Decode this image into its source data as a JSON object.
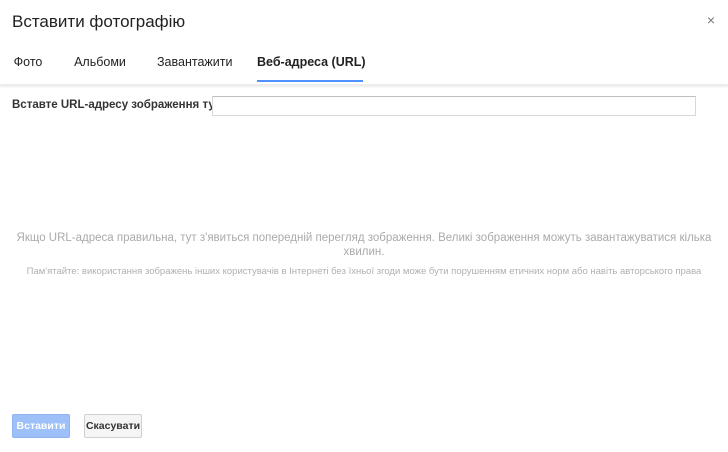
{
  "dialog": {
    "title": "Вставити фотографію",
    "close_glyph": "×"
  },
  "tabs": [
    {
      "label": "Фото",
      "active": false
    },
    {
      "label": "Альбоми",
      "active": false
    },
    {
      "label": "Завантажити",
      "active": false
    },
    {
      "label": "Веб-адреса (URL)",
      "active": true
    }
  ],
  "url_form": {
    "label": "Вставте URL-адресу зображення тут:",
    "value": "",
    "placeholder": ""
  },
  "messages": {
    "preview": "Якщо URL-адреса правильна, тут з'явиться попередній перегляд зображення. Великі зображення можуть завантажуватися кілька хвилин.",
    "copyright": "Пам'ятайте: використання зображень інших користувачів в Інтернеті без їхньої згоди може бути порушенням етичних норм або навіть авторського права"
  },
  "buttons": {
    "insert": "Вставити",
    "cancel": "Скасувати"
  },
  "colors": {
    "accent": "#4d90fe",
    "insert_disabled": "#9cc0f7"
  },
  "icons": {
    "close": "close-icon"
  }
}
